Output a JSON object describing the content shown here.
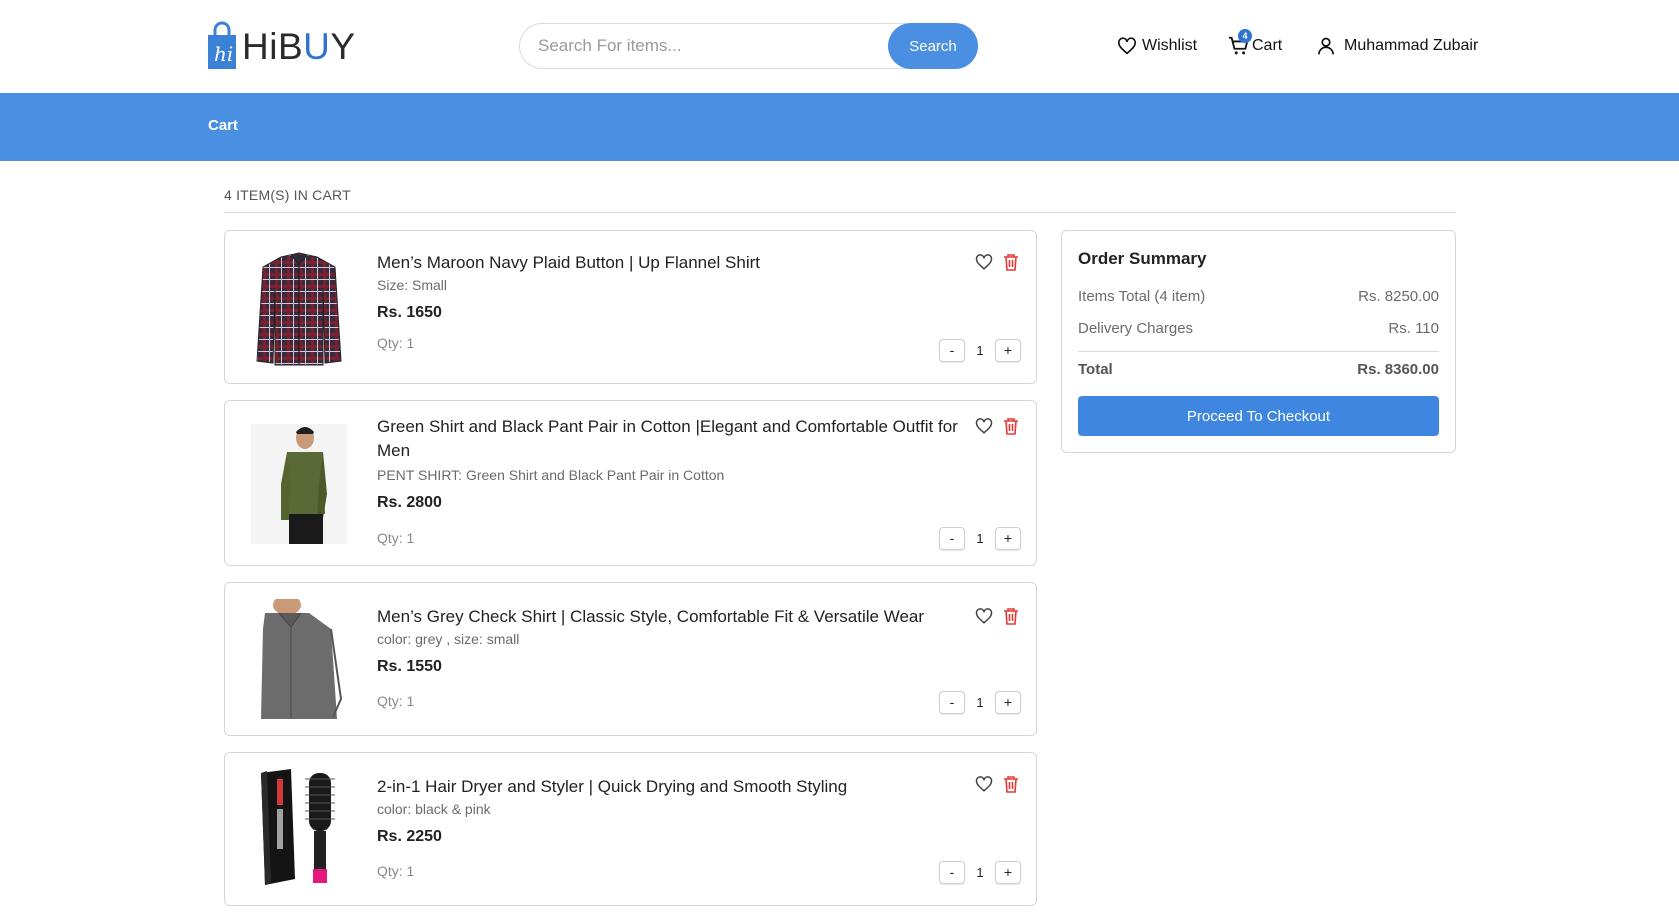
{
  "header": {
    "logo_text_dark": "HiB",
    "logo_text_blue": "U",
    "logo_text_dark2": "Y",
    "search_placeholder": "Search For items...",
    "search_button": "Search",
    "wishlist_label": "Wishlist",
    "cart_label": "Cart",
    "cart_count": "4",
    "user_name": "Muhammad Zubair"
  },
  "banner": {
    "title": "Cart"
  },
  "cart": {
    "count_label": "4 ITEM(S) IN CART",
    "items": [
      {
        "title": "Men’s Maroon Navy Plaid Button | Up Flannel Shirt",
        "subtitle": "Size: Small",
        "price": "Rs. 1650",
        "qty_label": "Qty: 1",
        "qty": "1",
        "minus": "-",
        "plus": "+",
        "image": "plaid-shirt-image"
      },
      {
        "title": "Green Shirt and Black Pant Pair in Cotton |Elegant and Comfortable Outfit for Men",
        "subtitle": "PENT SHIRT: Green Shirt and Black Pant Pair in Cotton",
        "price": "Rs. 2800",
        "qty_label": "Qty: 1",
        "qty": "1",
        "minus": "-",
        "plus": "+",
        "image": "green-shirt-model-image"
      },
      {
        "title": "Men’s Grey Check Shirt | Classic Style, Comfortable Fit & Versatile Wear",
        "subtitle": "color: grey , size: small",
        "price": "Rs. 1550",
        "qty_label": "Qty: 1",
        "qty": "1",
        "minus": "-",
        "plus": "+",
        "image": "grey-shirt-image"
      },
      {
        "title": "2-in-1 Hair Dryer and Styler | Quick Drying and Smooth Styling",
        "subtitle": "color: black & pink",
        "price": "Rs. 2250",
        "qty_label": "Qty: 1",
        "qty": "1",
        "minus": "-",
        "plus": "+",
        "image": "hair-dryer-image"
      }
    ]
  },
  "summary": {
    "title": "Order Summary",
    "items_total_label": "Items Total (4 item)",
    "items_total_value": "Rs. 8250.00",
    "delivery_label": "Delivery Charges",
    "delivery_value": "Rs. 110",
    "total_label": "Total",
    "total_value": "Rs. 8360.00",
    "checkout_button": "Proceed To Checkout"
  },
  "colors": {
    "brand_blue": "#4a90e2",
    "button_blue": "#3e86e0",
    "trash_red": "#e53935"
  }
}
